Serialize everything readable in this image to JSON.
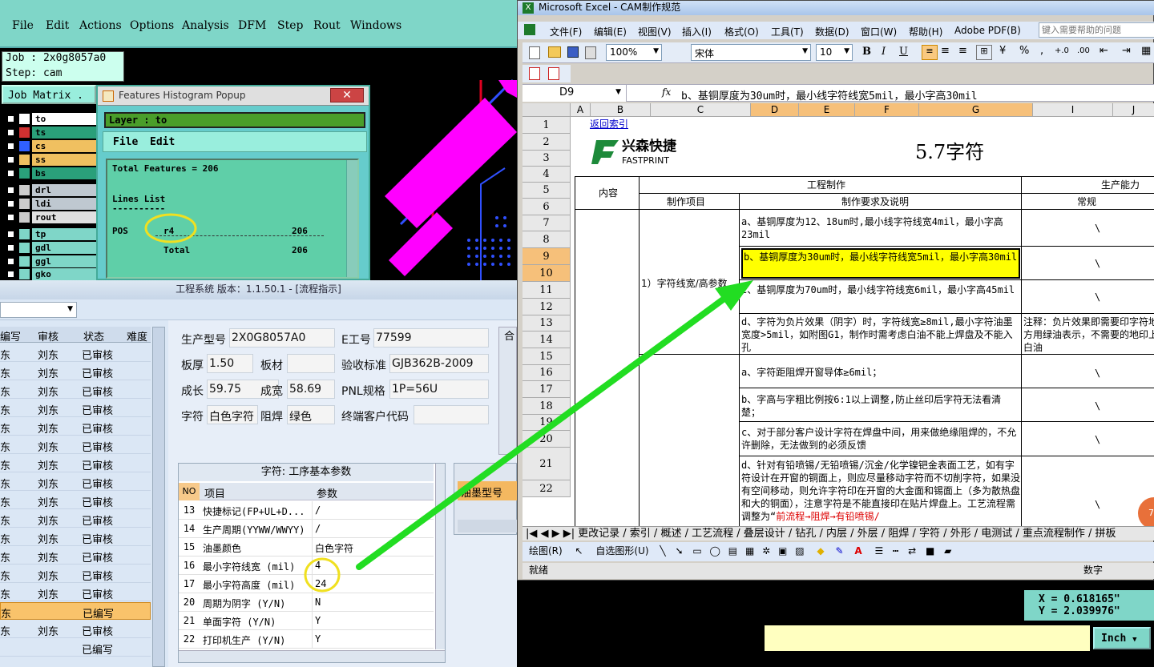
{
  "cam": {
    "menu": [
      "File",
      "Edit",
      "Actions",
      "Options",
      "Analysis",
      "DFM",
      "Step",
      "Rout",
      "Windows"
    ],
    "job_label": "Job : 2x0g8057a0",
    "step_label": "Step: cam",
    "job_matrix": "Job Matrix .",
    "layers": [
      {
        "name": "to",
        "color": "#ffffff"
      },
      {
        "name": "ts",
        "color": "#d03030"
      },
      {
        "name": "cs",
        "color": "#3060ff"
      },
      {
        "name": "ss",
        "color": "#f0c060"
      },
      {
        "name": "bs",
        "color": "#2aa07a"
      },
      {
        "name": "drl",
        "color": "#e0e0e0"
      },
      {
        "name": "ldi",
        "color": "#e0e0e0"
      },
      {
        "name": "rout",
        "color": "#e0e0e0"
      },
      {
        "name": "tp",
        "color": "#7fd6c8"
      },
      {
        "name": "gdl",
        "color": "#7fd6c8"
      },
      {
        "name": "ggl",
        "color": "#7fd6c8"
      },
      {
        "name": "gko",
        "color": "#7fd6c8"
      }
    ],
    "histogram": {
      "title": "Features Histogram Popup",
      "layer": "Layer :  to",
      "menu_file": "File",
      "menu_edit": "Edit",
      "total_features": "Total Features = 206",
      "lines_list": "Lines List",
      "dashes": "----------",
      "pos": "POS",
      "sym": "r4",
      "count": "206",
      "total_label": "Total",
      "total_count": "206"
    },
    "coord_x": "X = 0.618165\"",
    "coord_y": "Y = 2.039976\"",
    "unit_button": "Inch"
  },
  "workflow": {
    "title": "工程系统  版本：1.1.50.1 - [流程指示]",
    "list_headers": [
      "编写",
      "审核",
      "状态",
      "难度"
    ],
    "list_rows": [
      {
        "a": "东",
        "b": "刘东",
        "c": "已审核"
      },
      {
        "a": "东",
        "b": "刘东",
        "c": "已审核"
      },
      {
        "a": "东",
        "b": "刘东",
        "c": "已审核"
      },
      {
        "a": "东",
        "b": "刘东",
        "c": "已审核"
      },
      {
        "a": "东",
        "b": "刘东",
        "c": "已审核"
      },
      {
        "a": "东",
        "b": "刘东",
        "c": "已审核"
      },
      {
        "a": "东",
        "b": "刘东",
        "c": "已审核"
      },
      {
        "a": "东",
        "b": "刘东",
        "c": "已审核"
      },
      {
        "a": "东",
        "b": "刘东",
        "c": "已审核"
      },
      {
        "a": "东",
        "b": "刘东",
        "c": "已审核"
      },
      {
        "a": "东",
        "b": "刘东",
        "c": "已审核"
      },
      {
        "a": "东",
        "b": "刘东",
        "c": "已审核"
      },
      {
        "a": "东",
        "b": "刘东",
        "c": "已审核"
      },
      {
        "a": "东",
        "b": "刘东",
        "c": "已审核"
      },
      {
        "a": "东",
        "b": "",
        "c": "已编写"
      },
      {
        "a": "东",
        "b": "刘东",
        "c": "已审核"
      },
      {
        "a": "",
        "b": "",
        "c": "已编写"
      }
    ],
    "info": {
      "model_label": "生产型号",
      "model": "2X0G8057A0",
      "e_label": "E工号",
      "e": "77599",
      "thick_label": "板厚",
      "thick": "1.50",
      "mat_label": "板材",
      "mat": "",
      "std_label": "验收标准",
      "std": "GJB362B-2009",
      "len_label": "成长",
      "len": "59.75",
      "wid_label": "成宽",
      "wid": "58.69",
      "pnl_label": "PNL规格",
      "pnl": "1P=56U",
      "char_label": "字符",
      "char": "白色字符",
      "mask_label": "阻焊",
      "mask": "绿色",
      "cust_label": "终端客户代码",
      "cust": "",
      "right_stub": "合"
    },
    "params_title": "字符: 工序基本参数",
    "params_headers": [
      "NO",
      "项目",
      "参数"
    ],
    "params_rows": [
      {
        "no": "13",
        "item": "快捷标记(FP+UL+D...",
        "val": "/"
      },
      {
        "no": "14",
        "item": "生产周期(YYWW/WWYY)",
        "val": "/"
      },
      {
        "no": "15",
        "item": "油墨颜色",
        "val": "白色字符"
      },
      {
        "no": "16",
        "item": "最小字符线宽 (mil)",
        "val": "4"
      },
      {
        "no": "17",
        "item": "最小字符高度 (mil)",
        "val": "24"
      },
      {
        "no": "20",
        "item": "周期为阴字 (Y/N)",
        "val": "N"
      },
      {
        "no": "21",
        "item": "单面字符 (Y/N)",
        "val": "Y"
      },
      {
        "no": "22",
        "item": "打印机生产 (Y/N)",
        "val": "Y"
      }
    ],
    "ink_header": "油墨型号"
  },
  "excel": {
    "title": "Microsoft Excel - CAM制作规范",
    "menu": [
      "文件(F)",
      "编辑(E)",
      "视图(V)",
      "插入(I)",
      "格式(O)",
      "工具(T)",
      "数据(D)",
      "窗口(W)",
      "帮助(H)",
      "Adobe PDF(B)"
    ],
    "help_placeholder": "键入需要帮助的问题",
    "zoom": "100%",
    "font": "宋体",
    "size": "10",
    "cell_ref": "D9",
    "fx": "fx",
    "formula": "b、基铜厚度为30um时，最小线字符线宽5mil，最小字高30mil",
    "columns": [
      "A",
      "B",
      "C",
      "D",
      "E",
      "F",
      "G",
      "I",
      "J"
    ],
    "rows": [
      "1",
      "2",
      "3",
      "4",
      "5",
      "6",
      "7",
      "8",
      "9",
      "10",
      "11",
      "12",
      "13",
      "14",
      "15",
      "16",
      "17",
      "18",
      "19",
      "20",
      "21",
      "22"
    ],
    "link": "返回索引",
    "logo_cn": "兴森快捷",
    "logo_en": "FASTPRINT",
    "heading": "5.7字符",
    "h_content": "内容",
    "h_eng": "工程制作",
    "h_cap": "生产能力",
    "h_item": "制作项目",
    "h_req": "制作要求及说明",
    "h_std": "常规",
    "group1": "1）字符线宽/高参数",
    "req_a": "a、基铜厚度为12、18um时,最小线字符线宽4mil，最小字高23mil",
    "req_b": "b、基铜厚度为30um时，最小线字符线宽5mil，最小字高30mil",
    "req_c": "c、基铜厚度为70um时，最小线字符线宽6mil，最小字高45mil",
    "req_d": "d、字符为负片效果（阴字）时，字符线宽≥8mil,最小字符油墨宽度>5mil，如附图G1，制作时需考虑白油不能上焊盘及不能入孔",
    "note_d": "注释：负片效果即需要印字符地方用绿油表示，不需要的地印上白油",
    "req2_a": "a、字符距阻焊开窗导体≥6mil；",
    "req2_b": "b、字高与字粗比例按6:1以上调整,防止丝印后字符无法看清楚；",
    "req2_c": "c、对于部分客户设计字符在焊盘中间，用来做绝缘阻焊的，不允许删除，无法做到的必须反馈",
    "req2_d": "d、针对有铅喷锡/无铅喷锡/沉金/化学镍钯金表面工艺，如有字符设计在开窗的铜面上，则应尽量移动字符而不切削字符，如果没有空间移动，则允许字符印在开窗的大金面和锡面上（多为散热盘和大的铜面），注意字符是不能直接印在贴片焊盘上。工艺流程需调整为“",
    "req2_d_red": "前流程→阻焊→有铅喷锡/",
    "backslash": "\\",
    "tabs": "更改记录 / 索引 / 概述 / 工艺流程 / 叠层设计 / 钻孔 / 内层 / 外层 / 阻焊 / 字符 / 外形 / 电测试 / 重点流程制作 / 拼板",
    "draw_label": "绘图(R)",
    "autoshape": "自选图形(U)",
    "status_ready": "就绪",
    "status_num": "数字",
    "badge": "76"
  },
  "colors": {
    "cam_teal": "#7fd6c8",
    "highlight_yellow": "#ffff00",
    "arrow_green": "#22dd22",
    "circle_yellow": "#f0e020"
  }
}
